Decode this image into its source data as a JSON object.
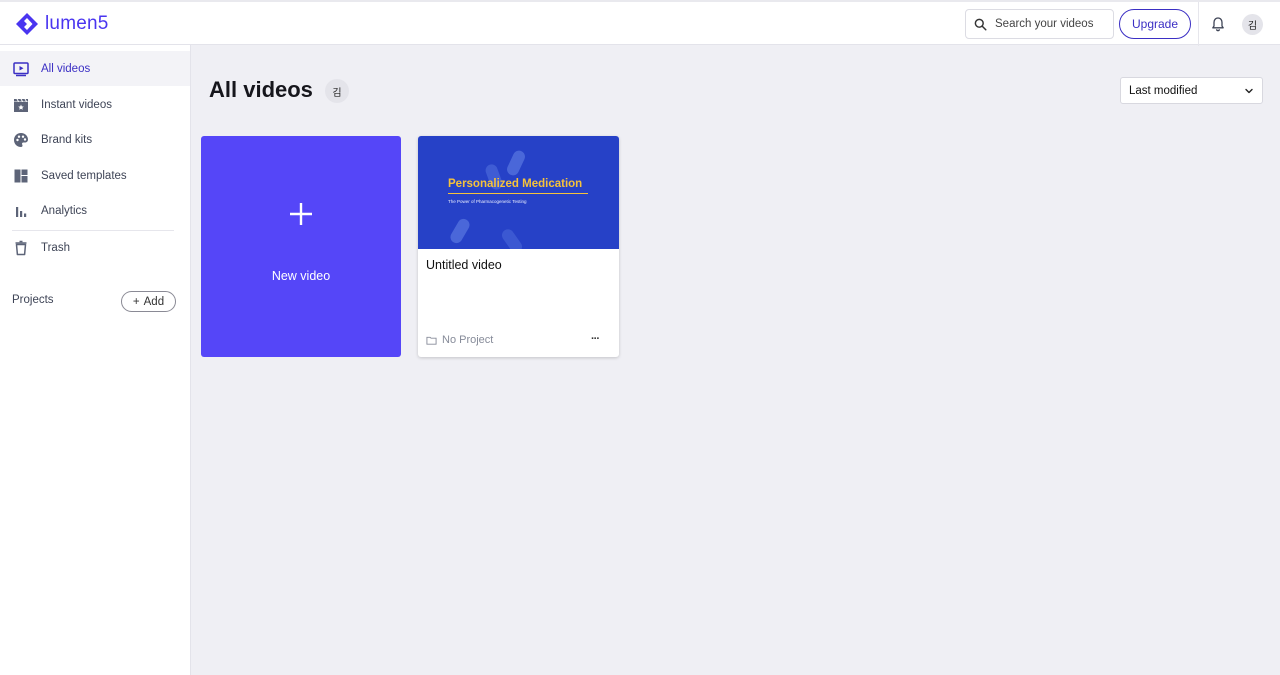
{
  "app": {
    "logo_text": "lumen5",
    "brand_color": "#4a35f0"
  },
  "header": {
    "search_placeholder": "Search your videos",
    "upgrade_label": "Upgrade",
    "avatar_initial": "김"
  },
  "sidebar": {
    "items": [
      {
        "label": "All videos",
        "icon": "play-screen-icon",
        "active": true
      },
      {
        "label": "Instant videos",
        "icon": "clapperboard-icon",
        "active": false
      },
      {
        "label": "Brand kits",
        "icon": "palette-icon",
        "active": false
      },
      {
        "label": "Saved templates",
        "icon": "template-icon",
        "active": false
      },
      {
        "label": "Analytics",
        "icon": "bar-chart-icon",
        "active": false
      },
      {
        "label": "Trash",
        "icon": "trash-icon",
        "active": false
      }
    ],
    "projects_label": "Projects",
    "add_label": "Add"
  },
  "main": {
    "title": "All videos",
    "owner_initial": "김",
    "sort": {
      "selected": "Last modified"
    },
    "new_video_label": "New video",
    "videos": [
      {
        "title": "Untitled video",
        "project": "No Project",
        "thumbnail_title": "Personalized Medication",
        "thumbnail_subtitle": "The Power of Pharmacogenetic Testing",
        "more_label": "···"
      }
    ]
  }
}
